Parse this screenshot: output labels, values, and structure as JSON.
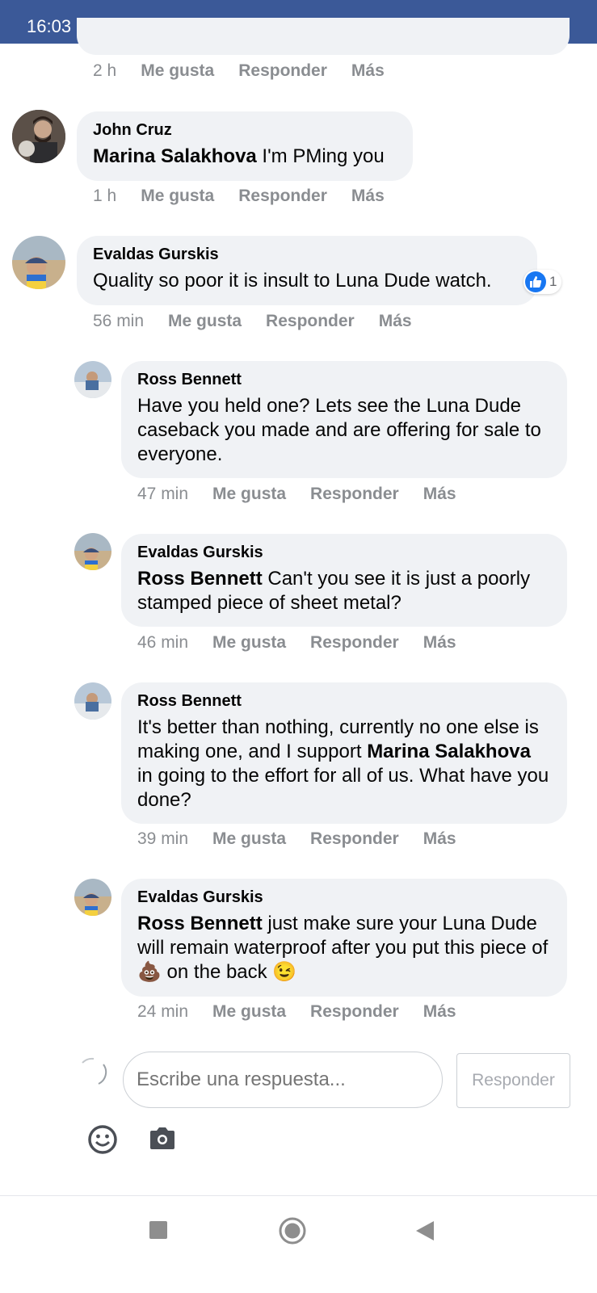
{
  "status_bar": {
    "time": "16:03",
    "battery": "16"
  },
  "colors": {
    "header": "#3b5998",
    "bubble": "#f0f2f5",
    "like": "#1877f2"
  },
  "actions": {
    "like": "Me gusta",
    "reply": "Responder",
    "more": "Más"
  },
  "comments": [
    {
      "time": "2 h"
    },
    {
      "author": "John Cruz",
      "mention": "Marina Salakhova",
      "text": " I'm PMing you",
      "time": "1 h"
    },
    {
      "author": "Evaldas Gurskis",
      "text": "Quality so poor it is insult to Luna Dude watch.",
      "time": "56 min",
      "reaction_count": "1"
    },
    {
      "author": "Ross Bennett",
      "text": "Have you held one? Lets see the Luna Dude caseback you made and are offering for sale to everyone.",
      "time": "47 min"
    },
    {
      "author": "Evaldas Gurskis",
      "mention": "Ross Bennett",
      "text": " Can't you see it is just a poorly stamped piece of sheet metal?",
      "time": "46 min"
    },
    {
      "author": "Ross Bennett",
      "text_before": "It's better than nothing, currently no one else is making one, and I support ",
      "mention": "Marina Salakhova",
      "text_after": " in going to the effort for all of us. What have you done?",
      "time": "39 min"
    },
    {
      "author": "Evaldas Gurskis",
      "mention": "Ross Bennett",
      "text_before": " just make sure your Luna Dude will remain waterproof after you put this piece of ",
      "text_mid": " on the back ",
      "emoji1": "💩",
      "emoji2": "😉",
      "time": "24 min"
    }
  ],
  "reply": {
    "placeholder": "Escribe una respuesta...",
    "button": "Responder"
  }
}
